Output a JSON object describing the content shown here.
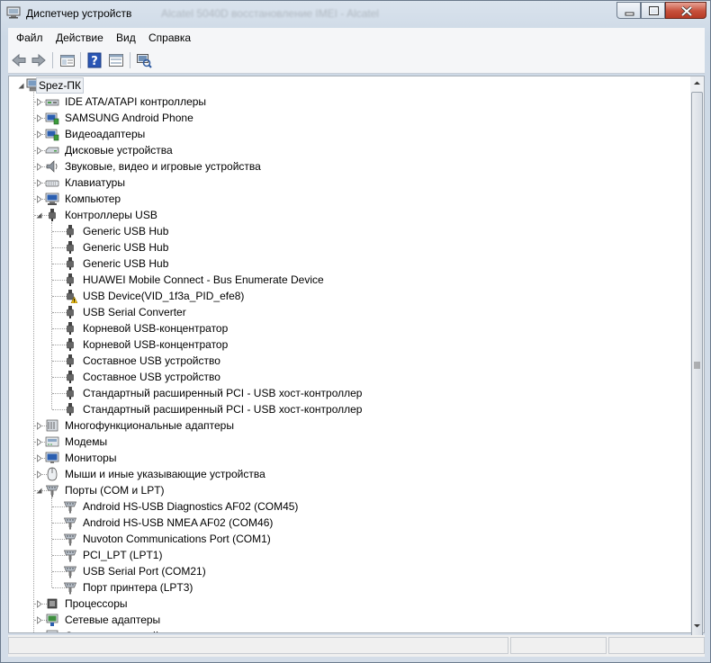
{
  "window": {
    "title": "Диспетчер устройств",
    "background_title": "Alcatel 5040D восстановление IMEI - Alcatel"
  },
  "menu": [
    "Файл",
    "Действие",
    "Вид",
    "Справка"
  ],
  "toolbar": [
    "back-icon",
    "forward-icon",
    "properties-icon",
    "help-icon",
    "show-hidden-icon",
    "scan-hardware-icon"
  ],
  "tree": {
    "root": "Spez-ПК",
    "items": [
      {
        "label": "IDE ATA/ATAPI контроллеры",
        "icon": "ide-controller-icon",
        "level": 1,
        "state": "collapsed"
      },
      {
        "label": "SAMSUNG Android Phone",
        "icon": "phone-icon",
        "level": 1,
        "state": "collapsed"
      },
      {
        "label": "Видеоадаптеры",
        "icon": "display-adapter-icon",
        "level": 1,
        "state": "collapsed"
      },
      {
        "label": "Дисковые устройства",
        "icon": "disk-drive-icon",
        "level": 1,
        "state": "collapsed"
      },
      {
        "label": "Звуковые, видео и игровые устройства",
        "icon": "speaker-icon",
        "level": 1,
        "state": "collapsed"
      },
      {
        "label": "Клавиатуры",
        "icon": "keyboard-icon",
        "level": 1,
        "state": "collapsed"
      },
      {
        "label": "Компьютер",
        "icon": "computer-icon",
        "level": 1,
        "state": "collapsed"
      },
      {
        "label": "Контроллеры USB",
        "icon": "usb-icon",
        "level": 1,
        "state": "expanded"
      },
      {
        "label": "Generic USB Hub",
        "icon": "usb-icon",
        "level": 2
      },
      {
        "label": "Generic USB Hub",
        "icon": "usb-icon",
        "level": 2
      },
      {
        "label": "Generic USB Hub",
        "icon": "usb-icon",
        "level": 2
      },
      {
        "label": "HUAWEI Mobile Connect - Bus Enumerate Device",
        "icon": "usb-icon",
        "level": 2
      },
      {
        "label": "USB Device(VID_1f3a_PID_efe8)",
        "icon": "usb-warning-icon",
        "level": 2
      },
      {
        "label": "USB Serial Converter",
        "icon": "usb-icon",
        "level": 2
      },
      {
        "label": "Корневой USB-концентратор",
        "icon": "usb-icon",
        "level": 2
      },
      {
        "label": "Корневой USB-концентратор",
        "icon": "usb-icon",
        "level": 2
      },
      {
        "label": "Составное USB устройство",
        "icon": "usb-icon",
        "level": 2
      },
      {
        "label": "Составное USB устройство",
        "icon": "usb-icon",
        "level": 2
      },
      {
        "label": "Стандартный расширенный PCI - USB хост-контроллер",
        "icon": "usb-icon",
        "level": 2
      },
      {
        "label": "Стандартный расширенный PCI - USB хост-контроллер",
        "icon": "usb-icon",
        "level": 2
      },
      {
        "label": "Многофункциональные адаптеры",
        "icon": "multifunction-icon",
        "level": 1,
        "state": "collapsed"
      },
      {
        "label": "Модемы",
        "icon": "modem-icon",
        "level": 1,
        "state": "collapsed"
      },
      {
        "label": "Мониторы",
        "icon": "monitor-icon",
        "level": 1,
        "state": "collapsed"
      },
      {
        "label": "Мыши и иные указывающие устройства",
        "icon": "mouse-icon",
        "level": 1,
        "state": "collapsed"
      },
      {
        "label": "Порты (COM и LPT)",
        "icon": "port-icon",
        "level": 1,
        "state": "expanded"
      },
      {
        "label": "Android HS-USB Diagnostics AF02 (COM45)",
        "icon": "port-icon",
        "level": 2
      },
      {
        "label": "Android HS-USB NMEA AF02 (COM46)",
        "icon": "port-icon",
        "level": 2
      },
      {
        "label": "Nuvoton Communications Port (COM1)",
        "icon": "port-icon",
        "level": 2
      },
      {
        "label": "PCI_LPT (LPT1)",
        "icon": "port-icon",
        "level": 2
      },
      {
        "label": "USB Serial Port (COM21)",
        "icon": "port-icon",
        "level": 2
      },
      {
        "label": "Порт принтера (LPT3)",
        "icon": "port-icon",
        "level": 2
      },
      {
        "label": "Процессоры",
        "icon": "processor-icon",
        "level": 1,
        "state": "collapsed"
      },
      {
        "label": "Сетевые адаптеры",
        "icon": "network-adapter-icon",
        "level": 1,
        "state": "collapsed"
      },
      {
        "label": "Системные устройства",
        "icon": "system-device-icon",
        "level": 1,
        "state": "collapsed"
      }
    ]
  },
  "colors": {
    "accent": "#2a6fc9",
    "warning": "#f2c318",
    "close": "#c7503b"
  }
}
